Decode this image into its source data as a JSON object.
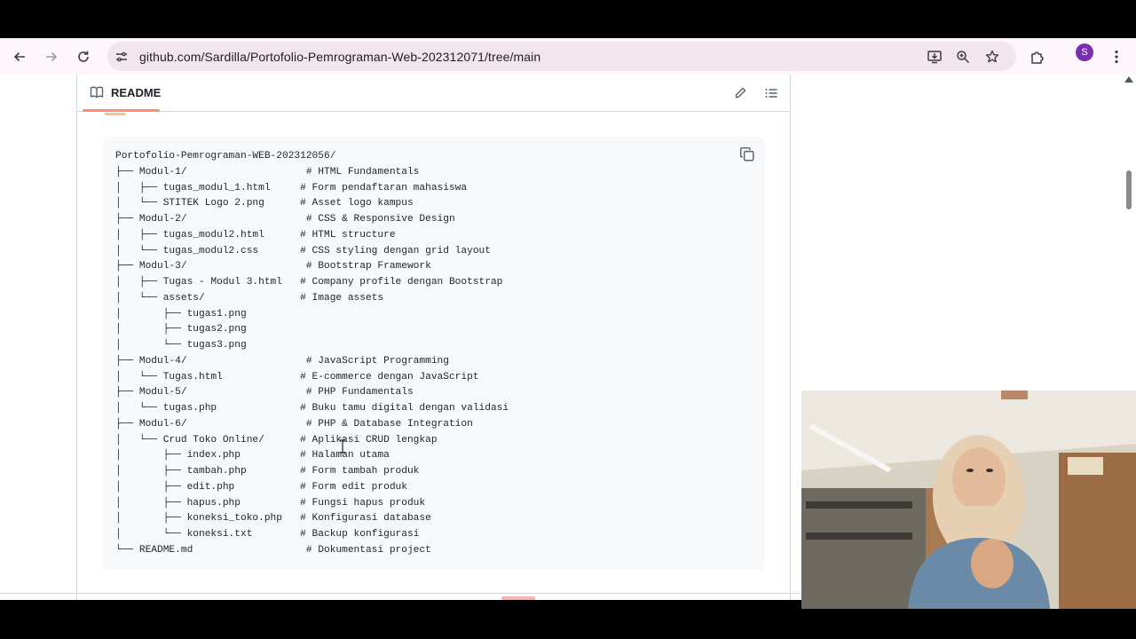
{
  "browser": {
    "url": "github.com/Sardilla/Portofolio-Pemrograman-Web-202312071/tree/main",
    "profile_initial": "S",
    "accent_color": "#7b2fb0"
  },
  "readme": {
    "tab_label": "README"
  },
  "tree": {
    "lines": [
      "Portofolio-Pemrograman-WEB-202312056/",
      "├── Modul-1/                    # HTML Fundamentals",
      "│   ├── tugas_modul_1.html     # Form pendaftaran mahasiswa",
      "│   └── STITEK Logo 2.png      # Asset logo kampus",
      "├── Modul-2/                    # CSS & Responsive Design",
      "│   ├── tugas_modul2.html      # HTML structure",
      "│   └── tugas_modul2.css       # CSS styling dengan grid layout",
      "├── Modul-3/                    # Bootstrap Framework",
      "│   ├── Tugas - Modul 3.html   # Company profile dengan Bootstrap",
      "│   └── assets/                # Image assets",
      "│       ├── tugas1.png",
      "│       ├── tugas2.png",
      "│       └── tugas3.png",
      "├── Modul-4/                    # JavaScript Programming",
      "│   └── Tugas.html             # E-commerce dengan JavaScript",
      "├── Modul-5/                    # PHP Fundamentals",
      "│   └── tugas.php              # Buku tamu digital dengan validasi",
      "├── Modul-6/                    # PHP & Database Integration",
      "│   └── Crud Toko Online/      # Aplikasi CRUD lengkap",
      "│       ├── index.php          # Halaman utama",
      "│       ├── tambah.php         # Form tambah produk",
      "│       ├── edit.php           # Form edit produk",
      "│       ├── hapus.php          # Fungsi hapus produk",
      "│       ├── koneksi_toko.php   # Konfigurasi database",
      "│       └── koneksi.txt        # Backup konfigurasi",
      "└── README.md                   # Dokumentasi project"
    ]
  }
}
